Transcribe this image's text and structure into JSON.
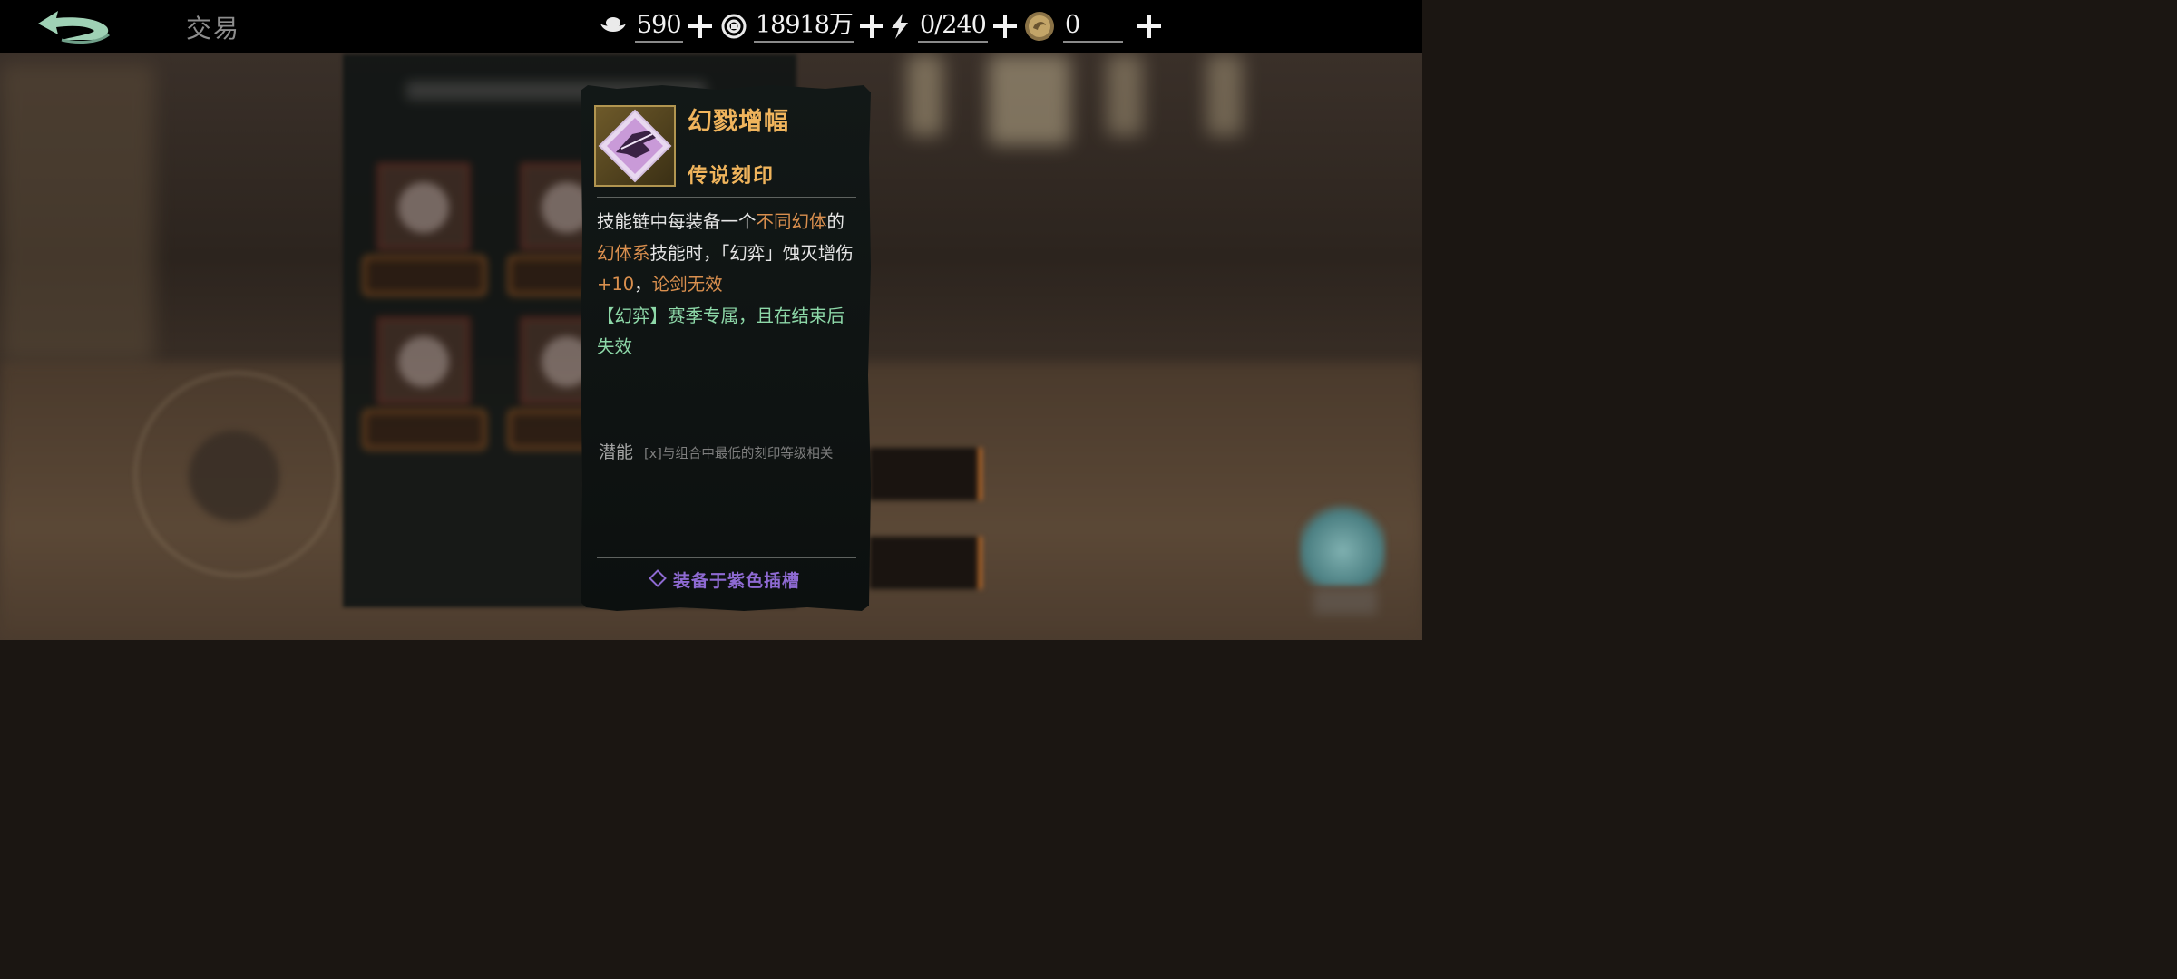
{
  "header": {
    "title": "交易",
    "resources": [
      {
        "icon": "silver-ingot-icon",
        "value": "590"
      },
      {
        "icon": "coin-icon",
        "value": "18918万"
      },
      {
        "icon": "lightning-icon",
        "value": "0/240"
      },
      {
        "icon": "gold-token-icon",
        "value": "0"
      }
    ]
  },
  "tooltip": {
    "item_name": "幻戮增幅",
    "rarity": "传说刻印",
    "description": {
      "p1": "技能链中每装备一个",
      "h1": "不同幻体",
      "p2": "的",
      "h2": "幻体系",
      "p3": "技能时，「幻弈」蚀灭增伤",
      "h3": "+10",
      "p4": "，",
      "h4": "论剑无效",
      "season": "【幻弈】赛季专属，且在结束后失效"
    },
    "potential_label": "潜能",
    "potential_value": "[x]与组合中最低的刻印等级相关",
    "slot_info": "装备于紫色插槽"
  },
  "colors": {
    "title_gold": "#f0b45c",
    "highlight_orange": "#d98f4e",
    "season_green": "#8dd8a8",
    "slot_purple": "#8e6ad2"
  }
}
